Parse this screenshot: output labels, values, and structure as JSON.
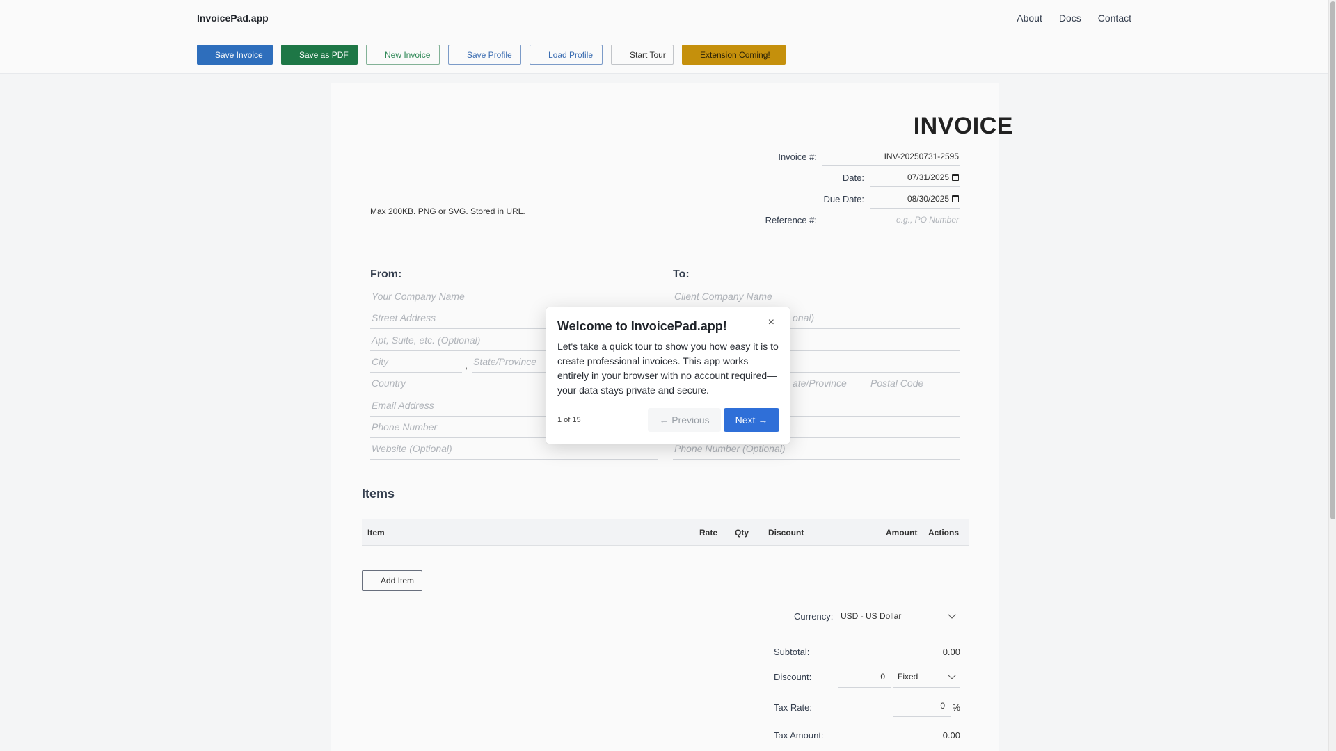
{
  "header": {
    "brand": "InvoicePad.app",
    "nav": [
      "About",
      "Docs",
      "Contact"
    ]
  },
  "toolbar": {
    "save_invoice": "Save Invoice",
    "save_pdf": "Save as PDF",
    "new_invoice": "New Invoice",
    "save_profile": "Save Profile",
    "load_profile": "Load Profile",
    "start_tour": "Start Tour",
    "extension": "Extension Coming!"
  },
  "invoice": {
    "title": "INVOICE",
    "number_label": "Invoice #:",
    "number": "INV-20250731-2595",
    "date_label": "Date:",
    "date": "07/31/2025",
    "due_label": "Due Date:",
    "due": "08/30/2025",
    "ref_label": "Reference #:",
    "ref_placeholder": "e.g., PO Number",
    "logo_note": "Max 200KB. PNG or SVG. Stored in URL."
  },
  "from": {
    "title": "From:",
    "company": "Your Company Name",
    "street": "Street Address",
    "apt": "Apt, Suite, etc. (Optional)",
    "city": "City",
    "comma": ",",
    "state": "State/Province",
    "country": "Country",
    "email": "Email Address",
    "phone": "Phone Number",
    "website": "Website (Optional)"
  },
  "to": {
    "title": "To:",
    "company": "Client Company Name",
    "row2_tail": "onal)",
    "state": "ate/Province",
    "postal": "Postal Code",
    "phone": "Phone Number (Optional)"
  },
  "items": {
    "title": "Items",
    "columns": [
      "Item",
      "Rate",
      "Qty",
      "Discount",
      "Amount",
      "Actions"
    ],
    "add_item": "Add Item"
  },
  "totals": {
    "currency_label": "Currency:",
    "currency": "USD - US Dollar",
    "subtotal_label": "Subtotal:",
    "subtotal": "0.00",
    "discount_label": "Discount:",
    "discount_value": "0",
    "discount_type": "Fixed",
    "tax_rate_label": "Tax Rate:",
    "tax_rate": "0",
    "percent": "%",
    "tax_amount_label": "Tax Amount:",
    "tax_amount": "0.00"
  },
  "tour": {
    "title": "Welcome to InvoicePad.app!",
    "close": "×",
    "body": "Let's take a quick tour to show you how easy it is to create professional invoices. This app works entirely in your browser with no account required—your data stays private and secure.",
    "progress": "1 of 15",
    "prev": "← Previous",
    "next": "Next →"
  },
  "colors": {
    "primary_blue": "#2f71c0",
    "green": "#1f7a48",
    "amber": "#c9930d",
    "next_button": "#2f6fd8"
  }
}
